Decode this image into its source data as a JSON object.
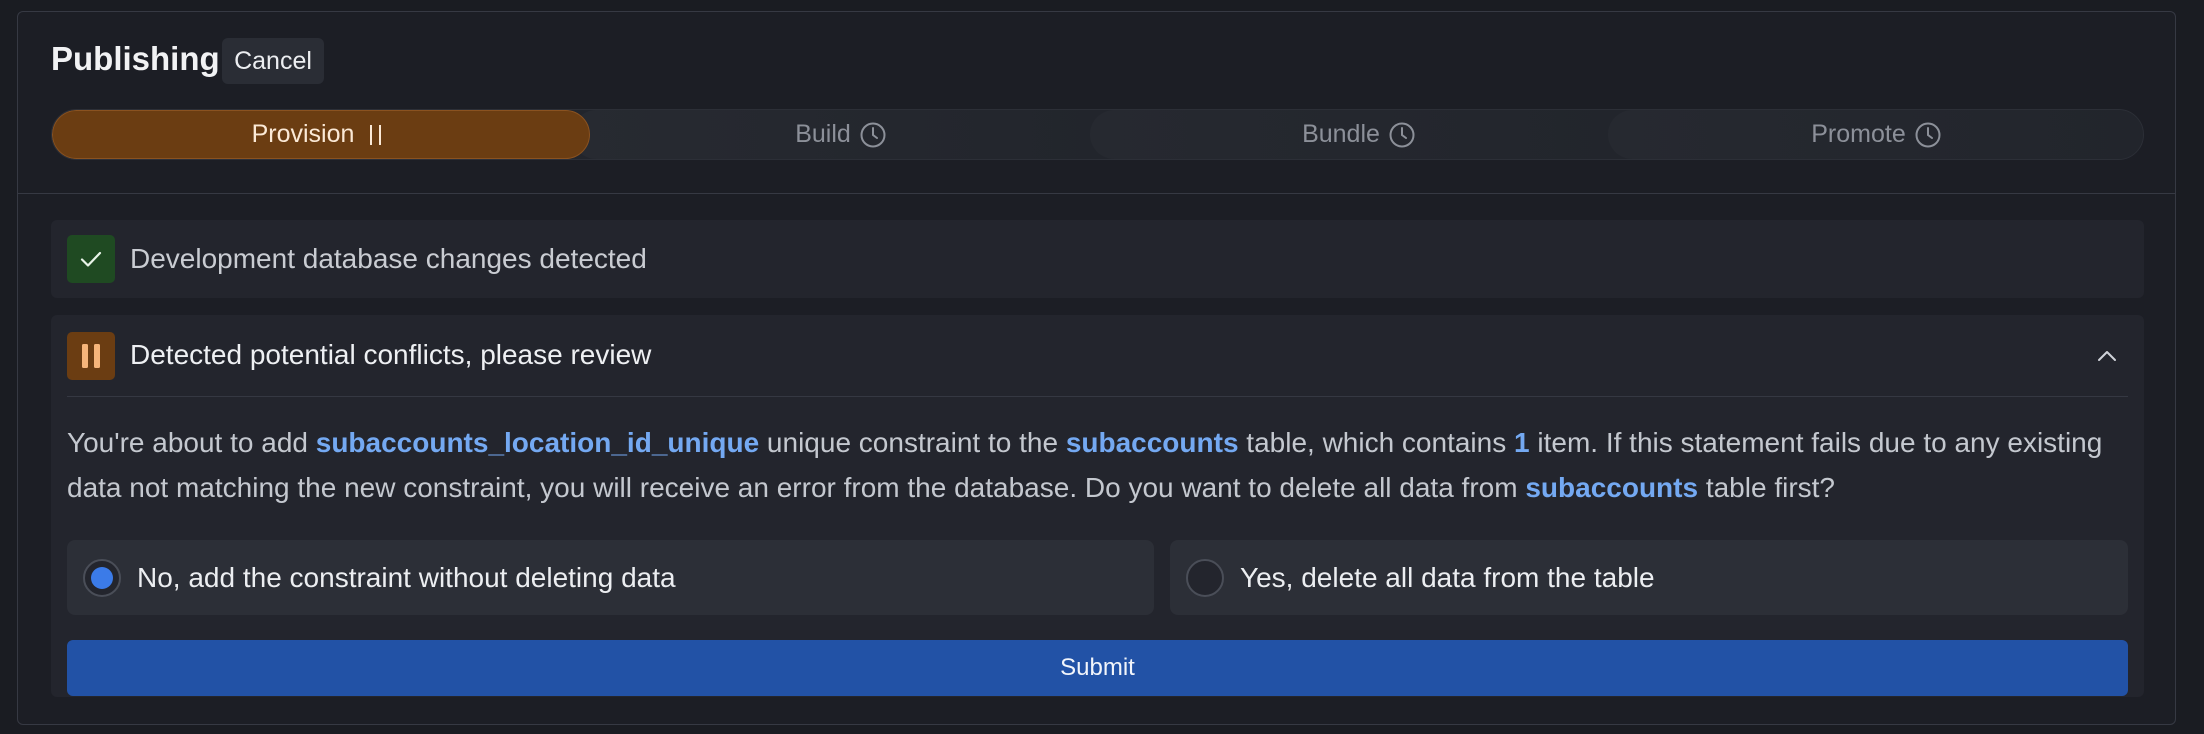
{
  "header": {
    "title": "Publishing",
    "cancel_label": "Cancel"
  },
  "steps": [
    {
      "label": "Provision",
      "status": "paused",
      "icon": "pause-icon"
    },
    {
      "label": "Build",
      "status": "pending",
      "icon": "clock-icon"
    },
    {
      "label": "Bundle",
      "status": "pending",
      "icon": "clock-icon"
    },
    {
      "label": "Promote",
      "status": "pending",
      "icon": "clock-icon"
    }
  ],
  "detected": {
    "label": "Development database changes detected",
    "icon": "check-icon"
  },
  "conflicts": {
    "title": "Detected potential conflicts, please review",
    "icon": "pause-icon",
    "message": {
      "p1": "You're about to add ",
      "constraint": "subaccounts_location_id_unique",
      "p2": " unique constraint to the ",
      "table": "subaccounts",
      "p3": " table, which contains ",
      "count": "1",
      "p4": " item. If this statement fails due to any existing data not matching the new constraint, you will receive an error from the database. Do you want to delete all data from ",
      "table2": "subaccounts",
      "p5": " table first?"
    },
    "options": [
      {
        "label": "No, add the constraint without deleting data",
        "selected": true
      },
      {
        "label": "Yes, delete all data from the table",
        "selected": false
      }
    ],
    "submit_label": "Submit"
  },
  "colors": {
    "accent": "#3b7be8",
    "active_step": "#6b3d12",
    "success": "#1f4a22",
    "highlight": "#74a9f2"
  }
}
